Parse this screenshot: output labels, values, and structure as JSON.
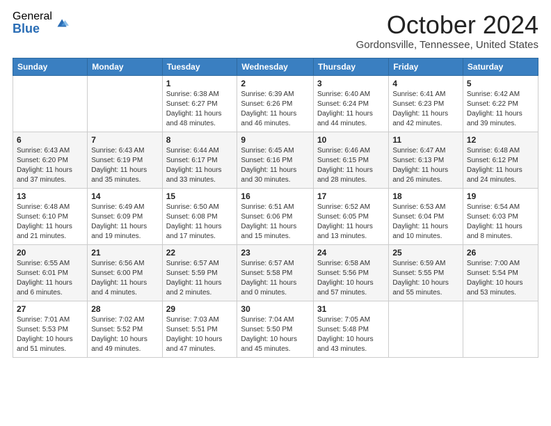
{
  "logo": {
    "general": "General",
    "blue": "Blue"
  },
  "header": {
    "month": "October 2024",
    "location": "Gordonsville, Tennessee, United States"
  },
  "days_of_week": [
    "Sunday",
    "Monday",
    "Tuesday",
    "Wednesday",
    "Thursday",
    "Friday",
    "Saturday"
  ],
  "weeks": [
    [
      null,
      null,
      {
        "day": 1,
        "sunrise": "6:38 AM",
        "sunset": "6:27 PM",
        "daylight": "11 hours and 48 minutes."
      },
      {
        "day": 2,
        "sunrise": "6:39 AM",
        "sunset": "6:26 PM",
        "daylight": "11 hours and 46 minutes."
      },
      {
        "day": 3,
        "sunrise": "6:40 AM",
        "sunset": "6:24 PM",
        "daylight": "11 hours and 44 minutes."
      },
      {
        "day": 4,
        "sunrise": "6:41 AM",
        "sunset": "6:23 PM",
        "daylight": "11 hours and 42 minutes."
      },
      {
        "day": 5,
        "sunrise": "6:42 AM",
        "sunset": "6:22 PM",
        "daylight": "11 hours and 39 minutes."
      }
    ],
    [
      {
        "day": 6,
        "sunrise": "6:43 AM",
        "sunset": "6:20 PM",
        "daylight": "11 hours and 37 minutes."
      },
      {
        "day": 7,
        "sunrise": "6:43 AM",
        "sunset": "6:19 PM",
        "daylight": "11 hours and 35 minutes."
      },
      {
        "day": 8,
        "sunrise": "6:44 AM",
        "sunset": "6:17 PM",
        "daylight": "11 hours and 33 minutes."
      },
      {
        "day": 9,
        "sunrise": "6:45 AM",
        "sunset": "6:16 PM",
        "daylight": "11 hours and 30 minutes."
      },
      {
        "day": 10,
        "sunrise": "6:46 AM",
        "sunset": "6:15 PM",
        "daylight": "11 hours and 28 minutes."
      },
      {
        "day": 11,
        "sunrise": "6:47 AM",
        "sunset": "6:13 PM",
        "daylight": "11 hours and 26 minutes."
      },
      {
        "day": 12,
        "sunrise": "6:48 AM",
        "sunset": "6:12 PM",
        "daylight": "11 hours and 24 minutes."
      }
    ],
    [
      {
        "day": 13,
        "sunrise": "6:48 AM",
        "sunset": "6:10 PM",
        "daylight": "11 hours and 21 minutes."
      },
      {
        "day": 14,
        "sunrise": "6:49 AM",
        "sunset": "6:09 PM",
        "daylight": "11 hours and 19 minutes."
      },
      {
        "day": 15,
        "sunrise": "6:50 AM",
        "sunset": "6:08 PM",
        "daylight": "11 hours and 17 minutes."
      },
      {
        "day": 16,
        "sunrise": "6:51 AM",
        "sunset": "6:06 PM",
        "daylight": "11 hours and 15 minutes."
      },
      {
        "day": 17,
        "sunrise": "6:52 AM",
        "sunset": "6:05 PM",
        "daylight": "11 hours and 13 minutes."
      },
      {
        "day": 18,
        "sunrise": "6:53 AM",
        "sunset": "6:04 PM",
        "daylight": "11 hours and 10 minutes."
      },
      {
        "day": 19,
        "sunrise": "6:54 AM",
        "sunset": "6:03 PM",
        "daylight": "11 hours and 8 minutes."
      }
    ],
    [
      {
        "day": 20,
        "sunrise": "6:55 AM",
        "sunset": "6:01 PM",
        "daylight": "11 hours and 6 minutes."
      },
      {
        "day": 21,
        "sunrise": "6:56 AM",
        "sunset": "6:00 PM",
        "daylight": "11 hours and 4 minutes."
      },
      {
        "day": 22,
        "sunrise": "6:57 AM",
        "sunset": "5:59 PM",
        "daylight": "11 hours and 2 minutes."
      },
      {
        "day": 23,
        "sunrise": "6:57 AM",
        "sunset": "5:58 PM",
        "daylight": "11 hours and 0 minutes."
      },
      {
        "day": 24,
        "sunrise": "6:58 AM",
        "sunset": "5:56 PM",
        "daylight": "10 hours and 57 minutes."
      },
      {
        "day": 25,
        "sunrise": "6:59 AM",
        "sunset": "5:55 PM",
        "daylight": "10 hours and 55 minutes."
      },
      {
        "day": 26,
        "sunrise": "7:00 AM",
        "sunset": "5:54 PM",
        "daylight": "10 hours and 53 minutes."
      }
    ],
    [
      {
        "day": 27,
        "sunrise": "7:01 AM",
        "sunset": "5:53 PM",
        "daylight": "10 hours and 51 minutes."
      },
      {
        "day": 28,
        "sunrise": "7:02 AM",
        "sunset": "5:52 PM",
        "daylight": "10 hours and 49 minutes."
      },
      {
        "day": 29,
        "sunrise": "7:03 AM",
        "sunset": "5:51 PM",
        "daylight": "10 hours and 47 minutes."
      },
      {
        "day": 30,
        "sunrise": "7:04 AM",
        "sunset": "5:50 PM",
        "daylight": "10 hours and 45 minutes."
      },
      {
        "day": 31,
        "sunrise": "7:05 AM",
        "sunset": "5:48 PM",
        "daylight": "10 hours and 43 minutes."
      },
      null,
      null
    ]
  ],
  "labels": {
    "sunrise": "Sunrise:",
    "sunset": "Sunset:",
    "daylight": "Daylight:"
  }
}
